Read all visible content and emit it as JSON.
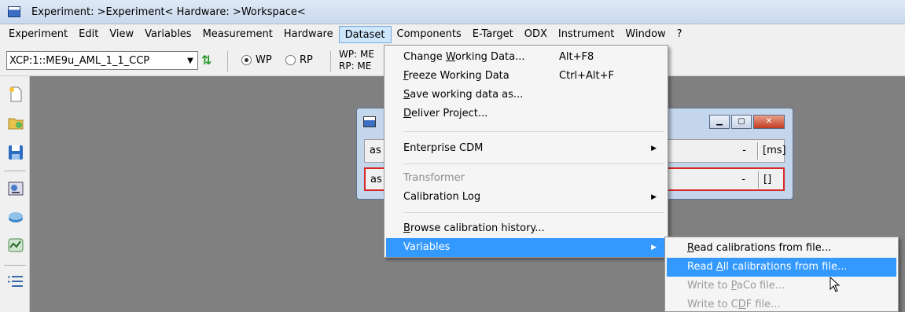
{
  "window": {
    "title": "Experiment: >Experiment< Hardware: >Workspace<"
  },
  "menubar": {
    "items": [
      "Experiment",
      "Edit",
      "View",
      "Variables",
      "Measurement",
      "Hardware",
      "Dataset",
      "Components",
      "E-Target",
      "ODX",
      "Instrument",
      "Window",
      "?"
    ]
  },
  "toolbar": {
    "device_combo_value": "XCP:1::ME9u_AML_1_1_CCP",
    "radio_wp": "WP",
    "radio_rp": "RP",
    "wp_label": "WP: ME",
    "rp_label": "RP: ME"
  },
  "mdi_window": {
    "rows": [
      {
        "label": "as",
        "value": "-",
        "unit": "[ms]"
      },
      {
        "label": "as",
        "value": "-",
        "unit": "[]"
      }
    ]
  },
  "dataset_menu": {
    "change_working_data": {
      "pre": "Change ",
      "acc": "W",
      "post": "orking Data...",
      "shortcut": "Alt+F8"
    },
    "freeze_working_data": {
      "pre": "",
      "acc": "F",
      "post": "reeze Working Data",
      "shortcut": "Ctrl+Alt+F"
    },
    "save_working_data_as": {
      "pre": "",
      "acc": "S",
      "post": "ave working data as..."
    },
    "deliver_project": {
      "pre": "",
      "acc": "D",
      "post": "eliver Project..."
    },
    "enterprise_cdm": "Enterprise CDM",
    "transformer": "Transformer",
    "calibration_log": "Calibration Log",
    "browse_calibration_history": {
      "pre": "",
      "acc": "B",
      "post": "rowse calibration history..."
    },
    "variables": "Variables"
  },
  "variables_submenu": {
    "read_calibrations": {
      "pre": "",
      "acc": "R",
      "post": "ead calibrations from file..."
    },
    "read_all_calibrations": {
      "pre": "Read ",
      "acc": "A",
      "post": "ll calibrations from file..."
    },
    "write_paco": {
      "pre": "Write to ",
      "acc": "P",
      "post": "aCo file..."
    },
    "write_cdf": {
      "pre": "Write to C",
      "acc": "D",
      "post": "F file..."
    }
  },
  "colors": {
    "highlight": "#3399ff",
    "error_border": "#d62828",
    "workspace": "#808080"
  }
}
